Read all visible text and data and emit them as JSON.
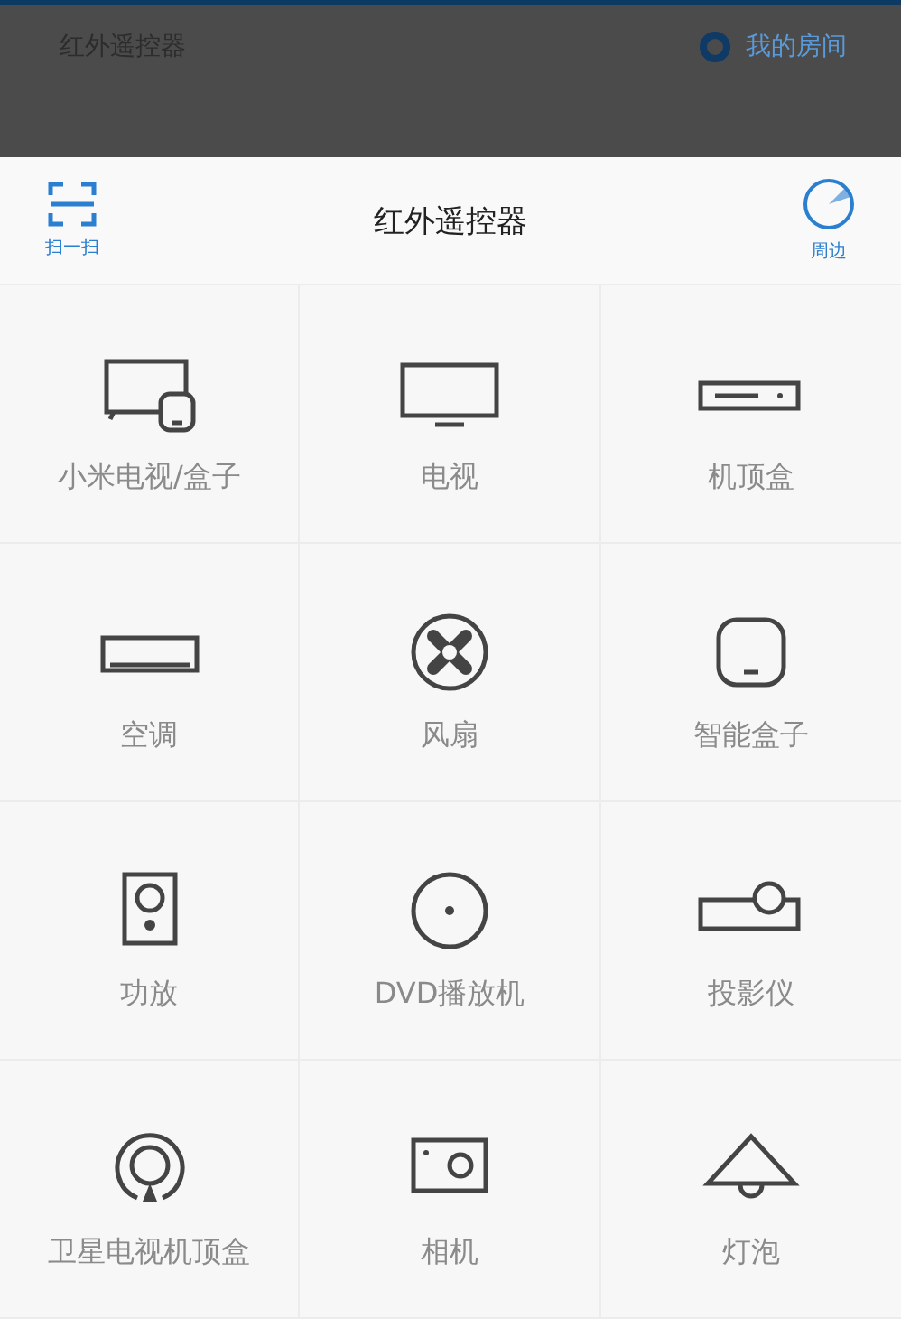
{
  "background_header": {
    "title": "红外遥控器",
    "room_link": "我的房间"
  },
  "toolbar": {
    "scan_label": "扫一扫",
    "title": "红外遥控器",
    "nearby_label": "周边"
  },
  "devices": [
    {
      "label": "小米电视/盒子"
    },
    {
      "label": "电视"
    },
    {
      "label": "机顶盒"
    },
    {
      "label": "空调"
    },
    {
      "label": "风扇"
    },
    {
      "label": "智能盒子"
    },
    {
      "label": "功放"
    },
    {
      "label": "DVD播放机"
    },
    {
      "label": "投影仪"
    },
    {
      "label": "卫星电视机顶盒"
    },
    {
      "label": "相机"
    },
    {
      "label": "灯泡"
    }
  ]
}
